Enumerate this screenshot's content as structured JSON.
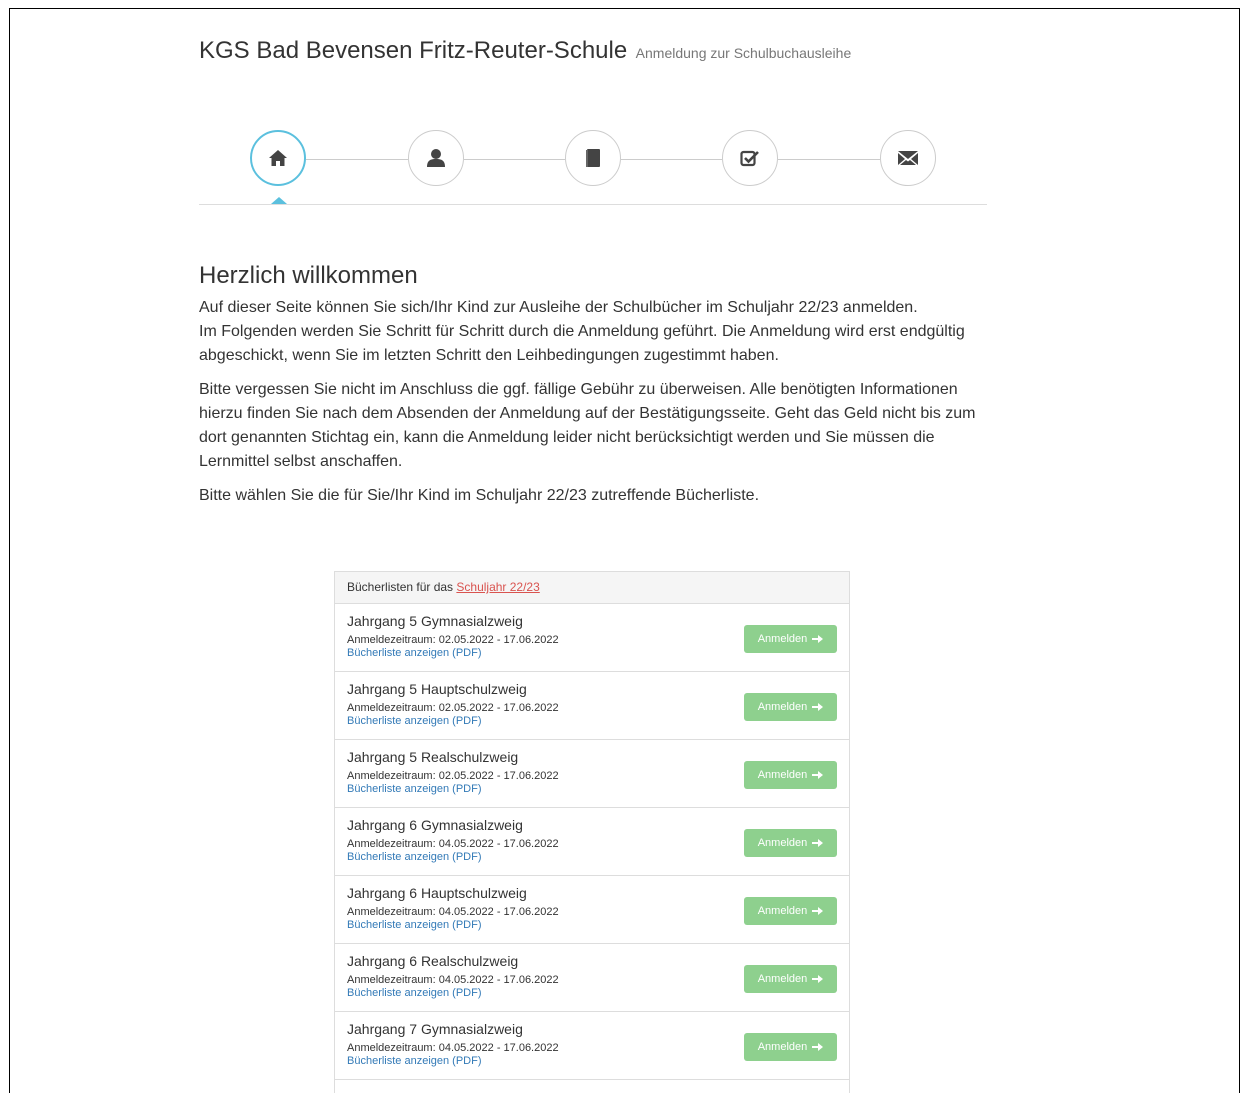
{
  "header": {
    "title": "KGS Bad Bevensen Fritz-Reuter-Schule",
    "subtitle": "Anmeldung zur Schulbuchausleihe"
  },
  "steps": [
    {
      "icon": "home-icon",
      "active": true
    },
    {
      "icon": "user-icon",
      "active": false
    },
    {
      "icon": "book-icon",
      "active": false
    },
    {
      "icon": "checkbox-icon",
      "active": false
    },
    {
      "icon": "envelope-icon",
      "active": false
    }
  ],
  "colors": {
    "accent": "#5bc0de",
    "button": "#8ed08e",
    "link": "#337ab7",
    "highlight_link": "#d9534f"
  },
  "welcome": {
    "heading": "Herzlich willkommen",
    "p1": "Auf dieser Seite können Sie sich/Ihr Kind zur Ausleihe der Schulbücher im Schuljahr 22/23 anmelden.",
    "p1b": "Im Folgenden werden Sie Schritt für Schritt durch die Anmeldung geführt. Die Anmeldung wird erst endgültig abgeschickt, wenn Sie im letzten Schritt den Leihbedingungen zugestimmt haben.",
    "p2": "Bitte vergessen Sie nicht im Anschluss die ggf. fällige Gebühr zu überweisen. Alle benötigten Informationen hierzu finden Sie nach dem Absenden der Anmeldung auf der Bestätigungsseite. Geht das Geld nicht bis zum dort genannten Stichtag ein, kann die Anmeldung leider nicht berücksichtigt werden und Sie müssen die Lernmittel selbst anschaffen.",
    "p3": "Bitte wählen Sie die für Sie/Ihr Kind im Schuljahr 22/23 zutreffende Bücherliste."
  },
  "booklists": {
    "heading_prefix": "Bücherlisten für das ",
    "heading_link": "Schuljahr 22/23",
    "button_label": "Anmelden",
    "items": [
      {
        "name": "Jahrgang 5 Gymnasialzweig",
        "period": "Anmeldezeitraum: 02.05.2022 - 17.06.2022",
        "pdf": "Bücherliste anzeigen (PDF)"
      },
      {
        "name": "Jahrgang 5 Hauptschulzweig",
        "period": "Anmeldezeitraum: 02.05.2022 - 17.06.2022",
        "pdf": "Bücherliste anzeigen (PDF)"
      },
      {
        "name": "Jahrgang 5 Realschulzweig",
        "period": "Anmeldezeitraum: 02.05.2022 - 17.06.2022",
        "pdf": "Bücherliste anzeigen (PDF)"
      },
      {
        "name": "Jahrgang 6 Gymnasialzweig",
        "period": "Anmeldezeitraum: 04.05.2022 - 17.06.2022",
        "pdf": "Bücherliste anzeigen (PDF)"
      },
      {
        "name": "Jahrgang 6 Hauptschulzweig",
        "period": "Anmeldezeitraum: 04.05.2022 - 17.06.2022",
        "pdf": "Bücherliste anzeigen (PDF)"
      },
      {
        "name": "Jahrgang 6 Realschulzweig",
        "period": "Anmeldezeitraum: 04.05.2022 - 17.06.2022",
        "pdf": "Bücherliste anzeigen (PDF)"
      },
      {
        "name": "Jahrgang 7 Gymnasialzweig",
        "period": "Anmeldezeitraum: 04.05.2022 - 17.06.2022",
        "pdf": "Bücherliste anzeigen (PDF)"
      }
    ]
  }
}
